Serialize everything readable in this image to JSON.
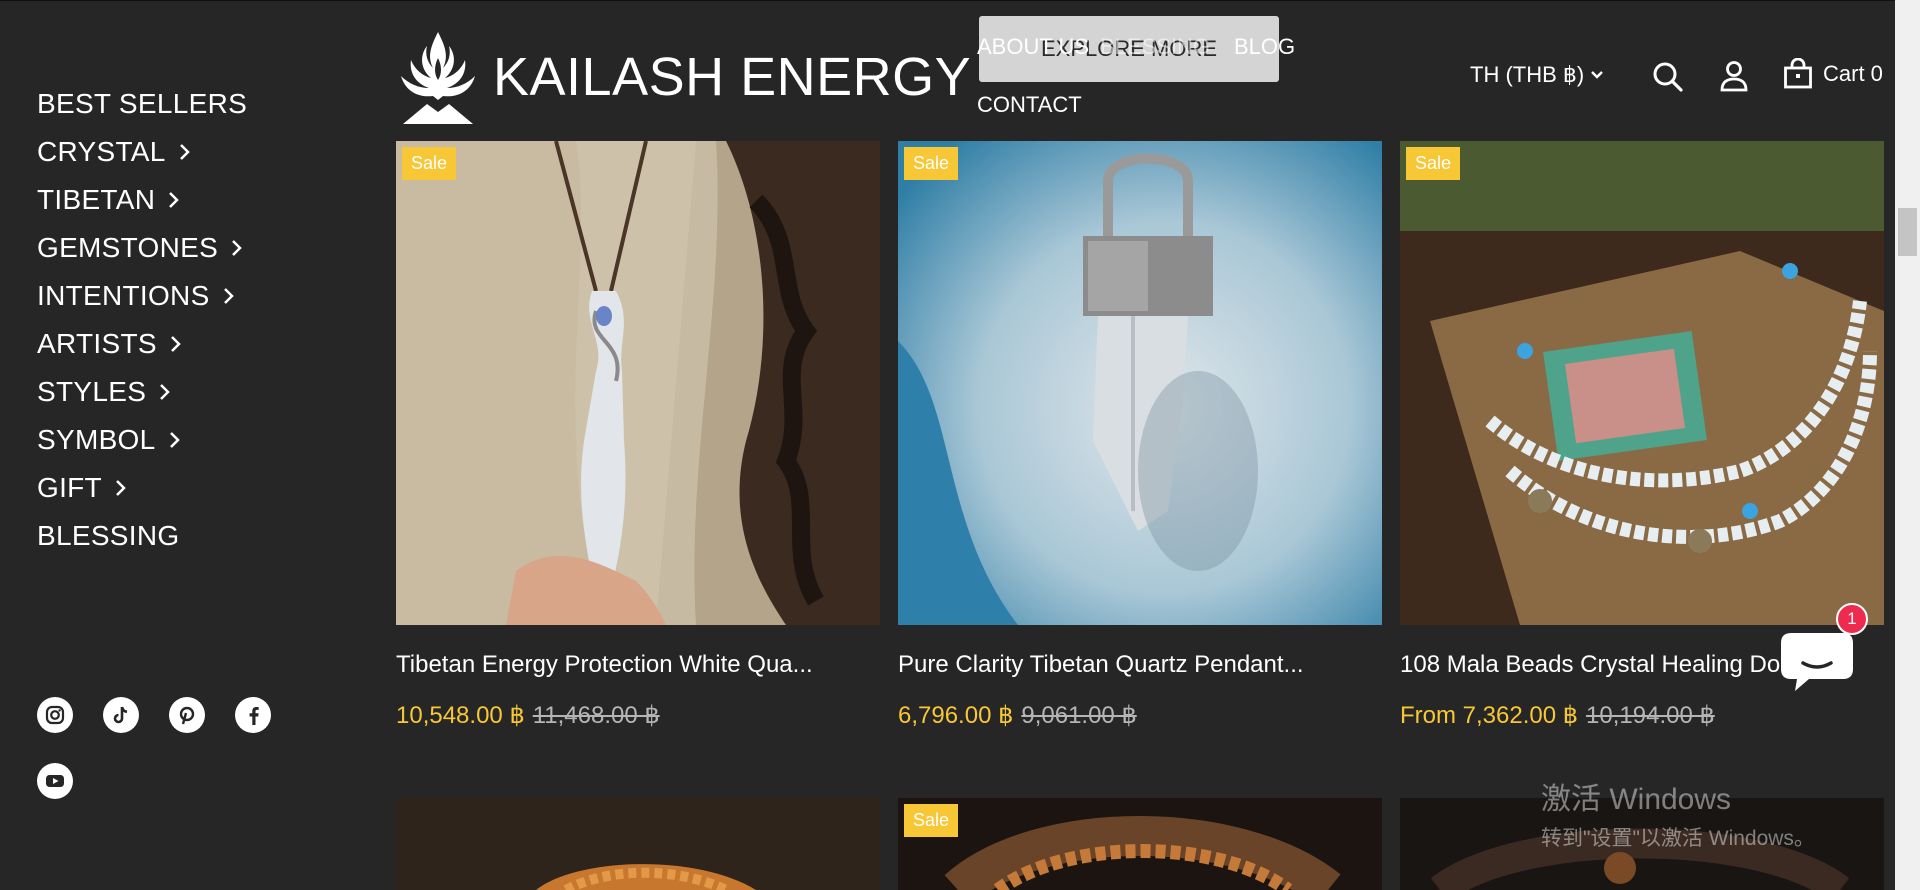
{
  "brand": {
    "name": "KAILASH ENERGY"
  },
  "sidebar": {
    "items": [
      {
        "label": "BEST SELLERS",
        "has_submenu": false
      },
      {
        "label": "CRYSTAL",
        "has_submenu": true
      },
      {
        "label": "TIBETAN",
        "has_submenu": true
      },
      {
        "label": "GEMSTONES",
        "has_submenu": true
      },
      {
        "label": "INTENTIONS",
        "has_submenu": true
      },
      {
        "label": "ARTISTS",
        "has_submenu": true
      },
      {
        "label": "STYLES",
        "has_submenu": true
      },
      {
        "label": "SYMBOL",
        "has_submenu": true
      },
      {
        "label": "GIFT",
        "has_submenu": true
      },
      {
        "label": "BLESSING",
        "has_submenu": false
      }
    ],
    "socials": [
      "instagram-icon",
      "tiktok-icon",
      "pinterest-icon",
      "facebook-icon",
      "youtube-icon"
    ]
  },
  "header": {
    "explore_label": "EXPLORE MORE",
    "about_label": "ABOUT US",
    "blessing_label": "BLESSING",
    "blog_label": "BLOG",
    "contact_label": "CONTACT",
    "currency_label": "TH (THB ฿)",
    "cart_label": "Cart 0"
  },
  "products": [
    {
      "badge": "Sale",
      "title": "Tibetan Energy Protection White Qua...",
      "price": "10,548.00 ฿",
      "compare_price": "11,468.00 ฿"
    },
    {
      "badge": "Sale",
      "title": "Pure Clarity Tibetan Quartz Pendant...",
      "price": "6,796.00 ฿",
      "compare_price": "9,061.00 ฿"
    },
    {
      "badge": "Sale",
      "title": "108 Mala Beads Crystal Healing Do...",
      "price": "From 7,362.00 ฿",
      "compare_price": "10,194.00 ฿"
    }
  ],
  "second_row": [
    {
      "badge": ""
    },
    {
      "badge": "Sale"
    },
    {
      "badge": ""
    }
  ],
  "chat": {
    "unread_count": "1"
  },
  "watermark": {
    "line1": "激活 Windows",
    "line2": "转到\"设置\"以激活 Windows。"
  },
  "colors": {
    "background": "#262626",
    "sale_accent": "#f7c736",
    "chat_badge": "#ee2a4f"
  }
}
